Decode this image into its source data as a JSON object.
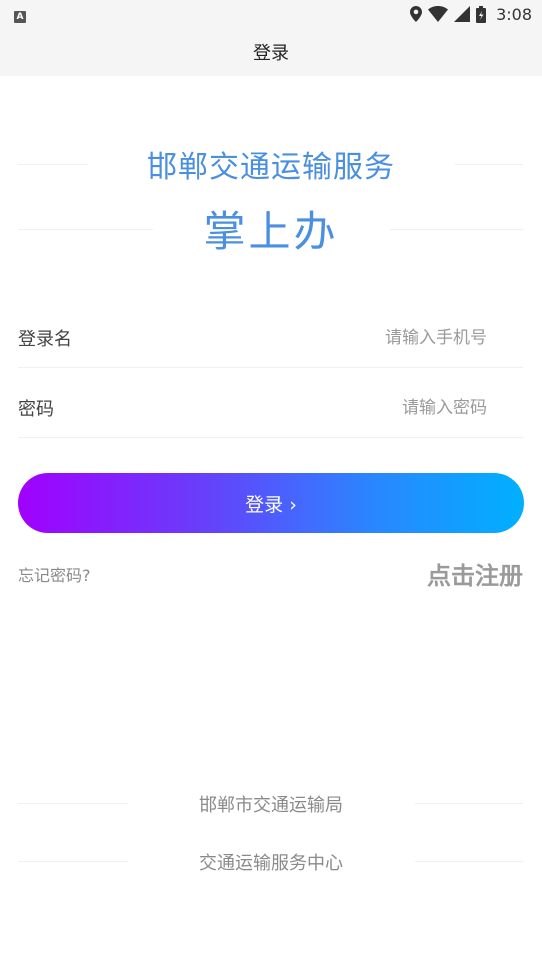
{
  "status_bar": {
    "app_icon_letter": "A",
    "time": "3:08",
    "icons": [
      "location-icon",
      "wifi-icon",
      "signal-icon",
      "battery-icon"
    ]
  },
  "title_bar": {
    "title": "登录"
  },
  "brand": {
    "subtitle": "邯郸交通运输服务",
    "title": "掌上办",
    "color": "#4a8fe0"
  },
  "form": {
    "username": {
      "label": "登录名",
      "placeholder": "请输入手机号",
      "value": ""
    },
    "password": {
      "label": "密码",
      "placeholder": "请输入密码",
      "value": ""
    },
    "login_label": "登录 ›",
    "forgot_label": "忘记密码?",
    "register_label": "点击注册"
  },
  "footer": {
    "line1": "邯郸市交通运输局",
    "line2": "交通运输服务中心"
  },
  "colors": {
    "gradient_start": "#a100ff",
    "gradient_end": "#00b0ff",
    "label_gray": "#8a8a8a"
  }
}
